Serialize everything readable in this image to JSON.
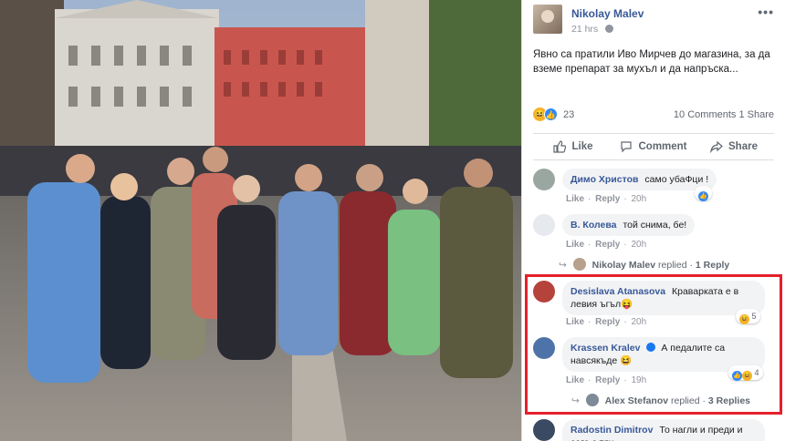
{
  "post": {
    "author": "Nikolay Malev",
    "time": "21 hrs",
    "text": "Явно са пратили Иво Мирчев до магазина, за да вземе препарат за мухъл и да напръска...",
    "reactions_count": "23",
    "comments_count": "10 Comments",
    "shares_count": "1 Share"
  },
  "actions": {
    "like": "Like",
    "comment": "Comment",
    "share": "Share"
  },
  "comment_meta": {
    "like": "Like",
    "reply": "Reply"
  },
  "comments": [
    {
      "author": "Димо Христов",
      "text": "само убаФци !",
      "time": "20h",
      "reaction_count": ""
    },
    {
      "author": "В. Колева",
      "text": "той снима, бе!",
      "time": "20h",
      "reaction_count": ""
    },
    {
      "author": "Desislava Atanasova",
      "text": "Краварката е в левия ъгъл😝",
      "time": "20h",
      "reaction_count": "5"
    },
    {
      "author": "Krassen Kralev",
      "text": "А педалите са навсякъде 😆",
      "time": "19h",
      "reaction_count": "4"
    },
    {
      "author": "Radostin Dimitrov",
      "text": "То нагли и преди и сега с тях",
      "time": "",
      "reaction_count": ""
    }
  ],
  "replies": [
    {
      "author": "Nikolay Malev",
      "label": "replied",
      "count": "1 Reply"
    },
    {
      "author": "Alex Stefanov",
      "label": "replied",
      "count": "3 Replies"
    }
  ],
  "colors": {
    "highlight": "#e5202b",
    "link": "#385898",
    "like": "#2d88ff"
  }
}
